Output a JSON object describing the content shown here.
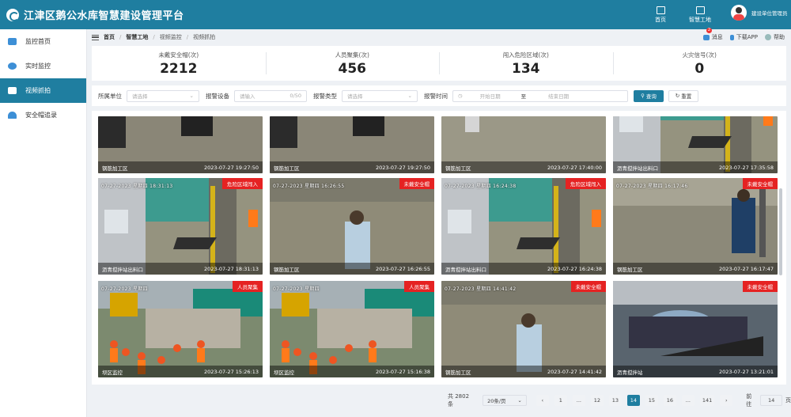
{
  "header": {
    "title": "江津区鹅公水库智慧建设管理平台",
    "nav": [
      {
        "label": "首页",
        "icon": "home-icon"
      },
      {
        "label": "智慧工地",
        "icon": "sitemap-icon"
      }
    ],
    "user": "建设单位管理员"
  },
  "sidebar": {
    "items": [
      {
        "label": "监控首页",
        "icon": "monitor-icon"
      },
      {
        "label": "实时监控",
        "icon": "camera-icon"
      },
      {
        "label": "视频抓拍",
        "icon": "snapshot-icon"
      },
      {
        "label": "安全帽追录",
        "icon": "helmet-icon"
      }
    ]
  },
  "breadcrumb": {
    "items": [
      "首页",
      "智慧工地",
      "视频监控",
      "视频抓拍"
    ]
  },
  "tools": {
    "message": "消息",
    "message_count": "2",
    "download": "下载APP",
    "help": "帮助"
  },
  "stats": [
    {
      "label": "未戴安全帽(次)",
      "value": "2212"
    },
    {
      "label": "人员聚集(次)",
      "value": "456"
    },
    {
      "label": "闯入危险区域(次)",
      "value": "134"
    },
    {
      "label": "火灾信号(次)",
      "value": "0"
    }
  ],
  "filters": {
    "unit_label": "所属单位",
    "unit_placeholder": "请选择",
    "device_label": "报警设备",
    "device_placeholder": "请输入",
    "device_count": "0/50",
    "type_label": "报警类型",
    "type_placeholder": "请选择",
    "time_label": "报警时间",
    "start_placeholder": "开始日期",
    "to": "至",
    "end_placeholder": "结束日期",
    "search_button": "查询",
    "reset_button": "重置"
  },
  "cards": [
    {
      "location": "钢筋加工区",
      "time": "2023-07-27 19:27:50",
      "tag": "",
      "osd": "",
      "scene": "steel"
    },
    {
      "location": "钢筋加工区",
      "time": "2023-07-27 19:27:50",
      "tag": "",
      "osd": "",
      "scene": "steel"
    },
    {
      "location": "钢筋加工区",
      "time": "2023-07-27 17:40:00",
      "tag": "",
      "osd": "",
      "scene": "steel2"
    },
    {
      "location": "沥青搅拌站出料口",
      "time": "2023-07-27 17:35:58",
      "tag": "",
      "osd": "",
      "scene": "asphalt"
    },
    {
      "location": "沥青搅拌站出料口",
      "time": "2023-07-27 18:31:13",
      "tag": "危险区域闯入",
      "osd": "07-27-2023 星期四 18:31:13",
      "scene": "asphalt"
    },
    {
      "location": "钢筋加工区",
      "time": "2023-07-27 16:26:55",
      "tag": "未戴安全帽",
      "osd": "07-27-2023 星期四 16:26:55",
      "scene": "steel3"
    },
    {
      "location": "沥青搅拌站出料口",
      "time": "2023-07-27 16:24:38",
      "tag": "危险区域闯入",
      "osd": "07-27-2023 星期四 16:24:38",
      "scene": "asphalt"
    },
    {
      "location": "钢筋加工区",
      "time": "2023-07-27 16:17:47",
      "tag": "未戴安全帽",
      "osd": "07-27-2023 星期四 16:17:46",
      "scene": "steel4"
    },
    {
      "location": "坝区监控",
      "time": "2023-07-27 15:26:13",
      "tag": "人员聚集",
      "osd": "07-27-2023 星期四",
      "scene": "dam"
    },
    {
      "location": "坝区监控",
      "time": "2023-07-27 15:16:38",
      "tag": "人员聚集",
      "osd": "07-27-2023 星期四",
      "scene": "dam"
    },
    {
      "location": "钢筋加工区",
      "time": "2023-07-27 14:41:42",
      "tag": "未戴安全帽",
      "osd": "07-27-2023 星期四 14:41:42",
      "scene": "steel3"
    },
    {
      "location": "沥青搅拌站",
      "time": "2023-07-27 13:21:01",
      "tag": "未戴安全帽",
      "osd": "",
      "scene": "plant"
    }
  ],
  "pagination": {
    "total": "共 2802 条",
    "page_size": "20条/页",
    "pages": [
      "1",
      "...",
      "12",
      "13",
      "14",
      "15",
      "16",
      "...",
      "141"
    ],
    "current": "14",
    "goto_label": "前往",
    "goto_value": "14",
    "goto_suffix": "页"
  }
}
